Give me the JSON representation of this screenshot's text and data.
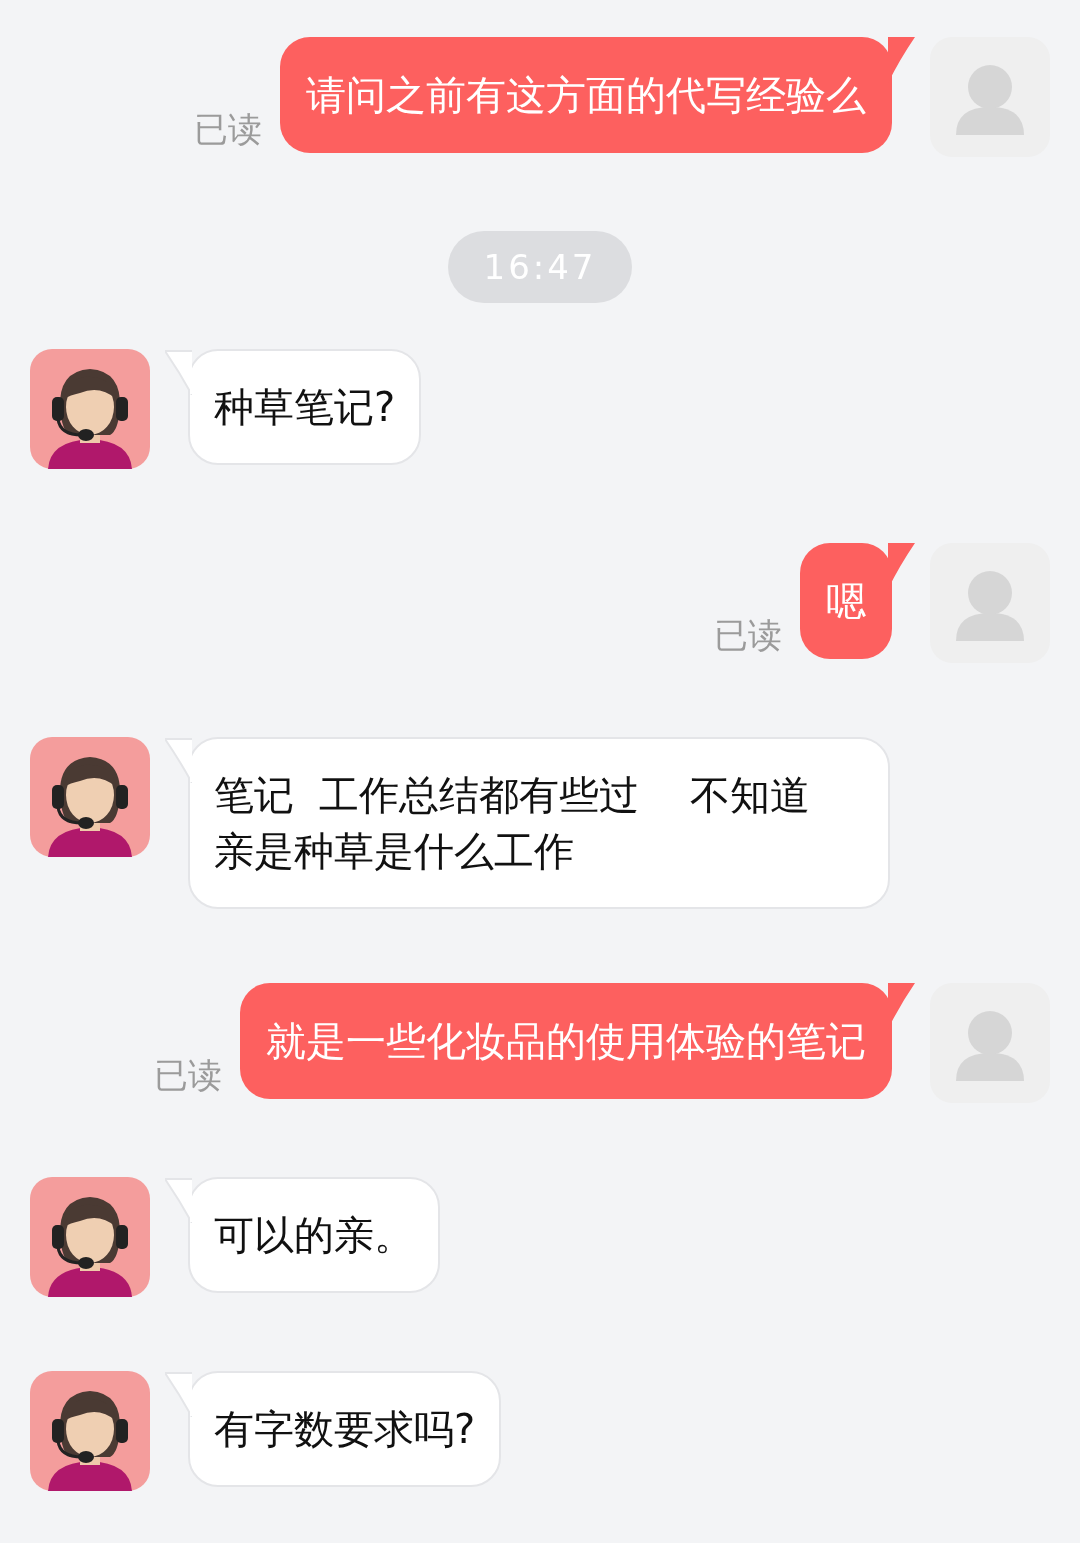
{
  "messages": [
    {
      "kind": "outgoing",
      "text": "请问之前有这方面的代写经验么",
      "status": "已读"
    },
    {
      "kind": "time",
      "text": "16:47"
    },
    {
      "kind": "incoming",
      "text": "种草笔记?"
    },
    {
      "kind": "outgoing",
      "text": "嗯",
      "status": "已读"
    },
    {
      "kind": "incoming",
      "text": "笔记  工作总结都有些过    不知道亲是种草是什么工作"
    },
    {
      "kind": "outgoing",
      "text": "就是一些化妆品的使用体验的笔记",
      "status": "已读"
    },
    {
      "kind": "incoming",
      "text": "可以的亲。"
    },
    {
      "kind": "incoming",
      "text": "有字数要求吗?"
    }
  ]
}
